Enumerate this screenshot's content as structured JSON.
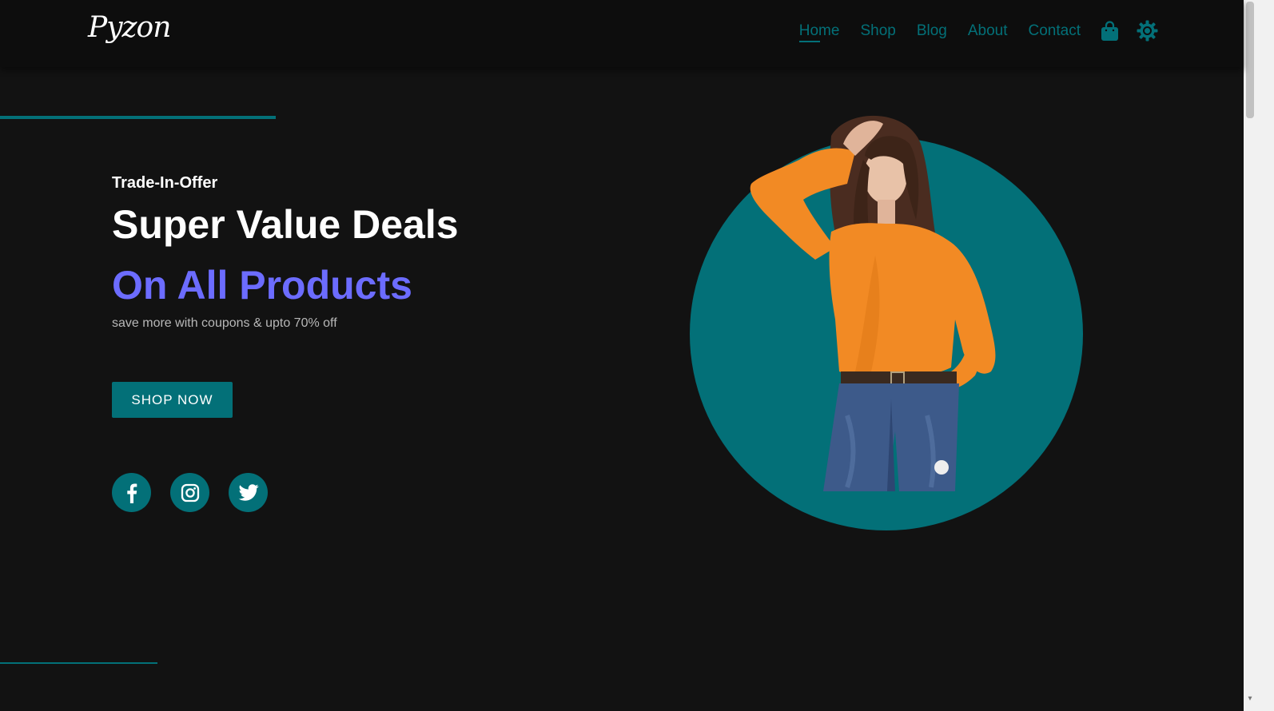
{
  "brand": {
    "logo_text": "Pyzon"
  },
  "nav": {
    "items": [
      {
        "label": "Home",
        "active": true
      },
      {
        "label": "Shop",
        "active": false
      },
      {
        "label": "Blog",
        "active": false
      },
      {
        "label": "About",
        "active": false
      },
      {
        "label": "Contact",
        "active": false
      }
    ],
    "icons": [
      "shopping-bag-icon",
      "gear-icon"
    ]
  },
  "hero": {
    "subtitle": "Trade-In-Offer",
    "title": "Super Value Deals",
    "title_accent": "On All Products",
    "description": "save more with coupons & upto 70% off",
    "cta_label": "SHOP NOW"
  },
  "social": {
    "icons": [
      "facebook-icon",
      "instagram-icon",
      "twitter-icon"
    ]
  },
  "colors": {
    "background": "#121212",
    "navbar": "#0d0d0d",
    "accent_teal": "#037078",
    "accent_purple": "#6c6cff",
    "text_primary": "#ffffff",
    "text_muted": "#b8b8b8",
    "sweater_orange": "#f28a24"
  }
}
